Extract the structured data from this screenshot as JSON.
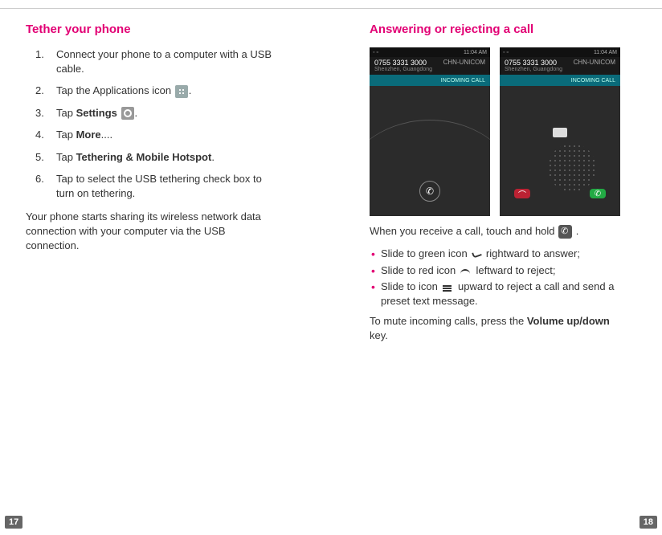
{
  "left": {
    "title": "Tether your phone",
    "steps": [
      {
        "n": "1.",
        "text": "Connect your phone to a computer with a USB cable."
      },
      {
        "n": "2.",
        "pre": "Tap the Applications icon ",
        "icon": "apps",
        "post": "."
      },
      {
        "n": "3.",
        "pre": "Tap ",
        "bold": "Settings",
        "icon": "gear",
        "post": "."
      },
      {
        "n": "4.",
        "pre": "Tap ",
        "bold": "More",
        "post": "...."
      },
      {
        "n": "5.",
        "pre": "Tap ",
        "bold": "Tethering & Mobile Hotspot",
        "post": "."
      },
      {
        "n": "6.",
        "text": "Tap to select the USB tethering check box to turn on tethering."
      }
    ],
    "footer": "Your phone starts sharing its wireless network data connection with your computer via the USB connection.",
    "pagenum": "17"
  },
  "right": {
    "title": "Answering or rejecting a call",
    "phone": {
      "time": "11:04 AM",
      "number": "0755 3331 3000",
      "carrier": "CHN-UNICOM",
      "location": "Shenzhen, Guangdong",
      "incoming_label": "INCOMING CALL"
    },
    "intro_pre": "When you receive a call, touch and hold ",
    "intro_post": " .",
    "bullets": [
      {
        "pre": "Slide to green icon ",
        "icon": "answer-green",
        "post": " rightward to answer;"
      },
      {
        "pre": "Slide to red icon ",
        "icon": "reject-red",
        "post": " leftward to reject;"
      },
      {
        "pre": "Slide to icon ",
        "icon": "msg",
        "post": " upward to reject a call and send a preset text message."
      }
    ],
    "mute_pre": "To mute incoming calls, press the ",
    "mute_bold": "Volume up/down",
    "mute_post": " key.",
    "pagenum": "18"
  }
}
